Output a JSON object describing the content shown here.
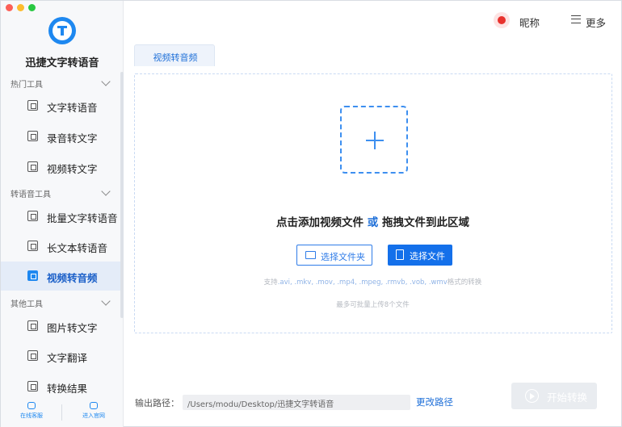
{
  "app": {
    "name": "迅捷文字转语音"
  },
  "window_controls": [
    "close",
    "minimize",
    "zoom"
  ],
  "header": {
    "nickname": "昵称",
    "more_label": "更多"
  },
  "sidebar": {
    "sections": [
      {
        "label": "热门工具",
        "items": [
          {
            "label": "文字转语音",
            "icon": "text-to-speech-icon"
          },
          {
            "label": "录音转文字",
            "icon": "recording-to-text-icon"
          },
          {
            "label": "视频转文字",
            "icon": "video-to-text-icon"
          }
        ]
      },
      {
        "label": "转语音工具",
        "items": [
          {
            "label": "批量文字转语音",
            "icon": "batch-text-to-speech-icon"
          },
          {
            "label": "长文本转语音",
            "icon": "long-text-to-speech-icon"
          },
          {
            "label": "视频转音频",
            "icon": "video-to-audio-icon",
            "active": true
          }
        ]
      },
      {
        "label": "其他工具",
        "items": [
          {
            "label": "图片转文字",
            "icon": "image-to-text-icon"
          },
          {
            "label": "文字翻译",
            "icon": "translate-icon"
          },
          {
            "label": "转换结果",
            "icon": "results-icon"
          }
        ]
      }
    ],
    "footer": {
      "support_label": "在线客服",
      "website_label": "进入官网"
    }
  },
  "main": {
    "tab_label": "视频转音频",
    "drop_text_a": "点击添加视频文件",
    "drop_text_or": "或",
    "drop_text_b": "拖拽文件到此区域",
    "select_folder_label": "选择文件夹",
    "select_file_label": "选择文件",
    "support_prefix": "支持",
    "supported_formats": ".avi, .mkv, .mov, .mp4, .mpeg, .rmvb, .vob, .wmv",
    "support_suffix": "格式的转换",
    "limit_text": "最多可批量上传8个文件"
  },
  "footer": {
    "output_label": "输出路径：",
    "output_path": "/Users/modu/Desktop/迅捷文字转语音",
    "change_path_label": "更改路径",
    "start_label": "开始转换"
  },
  "colors": {
    "accent": "#1470ea",
    "active_bg": "#e4ecf8",
    "disabled_btn": "#e9ecf0"
  }
}
